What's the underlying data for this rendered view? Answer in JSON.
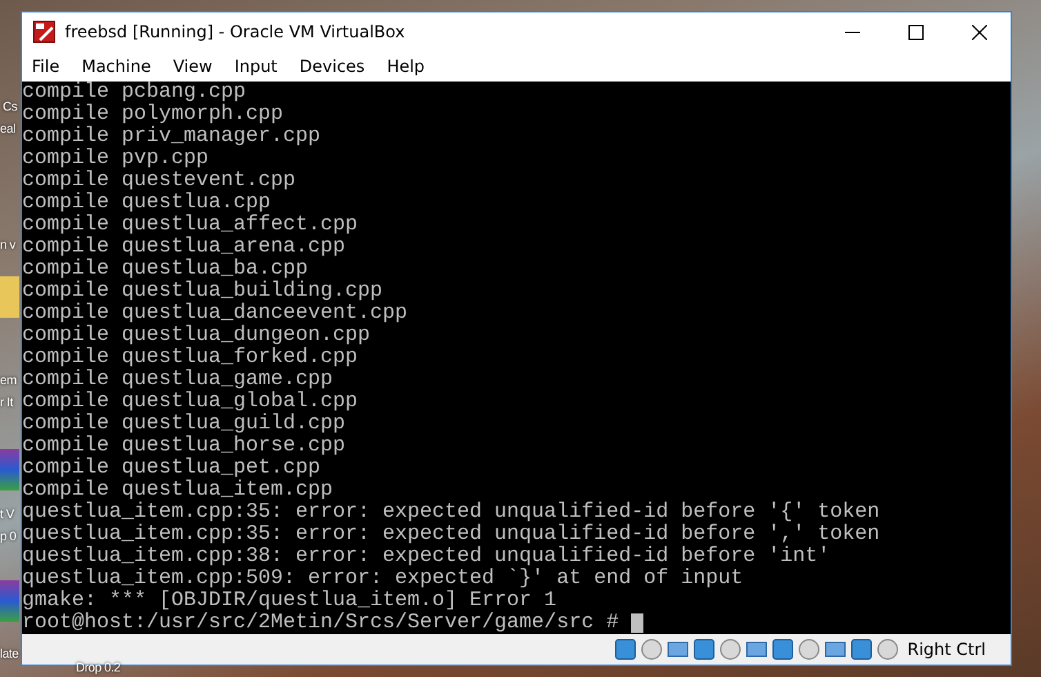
{
  "desktop": {
    "icon_labels": [
      "Cs",
      "eal",
      "n v",
      "em",
      "r It",
      "t V",
      "p 0",
      "late",
      "Drop 0.2"
    ]
  },
  "window": {
    "title": "freebsd [Running] - Oracle VM VirtualBox"
  },
  "menu": [
    "File",
    "Machine",
    "View",
    "Input",
    "Devices",
    "Help"
  ],
  "terminal": {
    "lines": [
      "compile pcbang.cpp",
      "compile polymorph.cpp",
      "compile priv_manager.cpp",
      "compile pvp.cpp",
      "compile questevent.cpp",
      "compile questlua.cpp",
      "compile questlua_affect.cpp",
      "compile questlua_arena.cpp",
      "compile questlua_ba.cpp",
      "compile questlua_building.cpp",
      "compile questlua_danceevent.cpp",
      "compile questlua_dungeon.cpp",
      "compile questlua_forked.cpp",
      "compile questlua_game.cpp",
      "compile questlua_global.cpp",
      "compile questlua_guild.cpp",
      "compile questlua_horse.cpp",
      "compile questlua_pet.cpp",
      "compile questlua_item.cpp",
      "questlua_item.cpp:35: error: expected unqualified-id before '{' token",
      "questlua_item.cpp:35: error: expected unqualified-id before ',' token",
      "questlua_item.cpp:38: error: expected unqualified-id before 'int'",
      "questlua_item.cpp:509: error: expected `}' at end of input",
      "gmake: *** [OBJDIR/questlua_item.o] Error 1",
      "root@host:/usr/src/2Metin/Srcs/Server/game/src #"
    ]
  },
  "status_bar": {
    "host_key": "Right Ctrl"
  }
}
